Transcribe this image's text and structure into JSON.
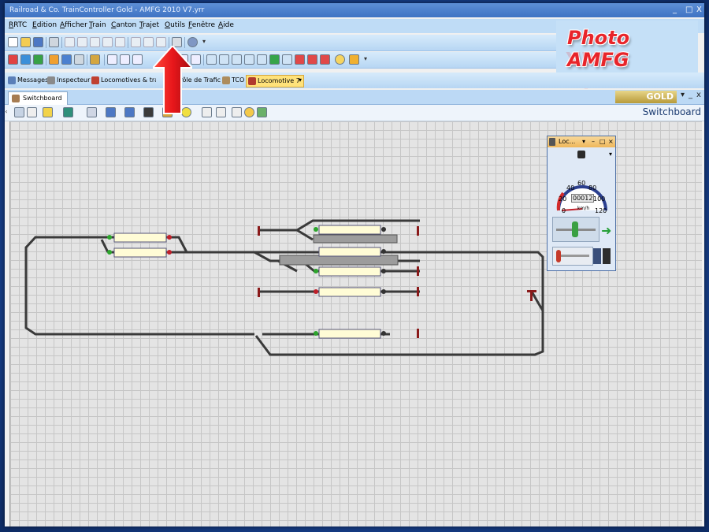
{
  "window": {
    "title": "Railroad & Co. TrainController Gold - AMFG 2010 V7.yrr",
    "controls": [
      "_",
      "□",
      "X"
    ]
  },
  "menu": [
    "RRTC",
    "Edition",
    "Afficher",
    "Train",
    "Canton",
    "Trajet",
    "Outils",
    "Fenêtre",
    "Aide"
  ],
  "brand": {
    "logo_text": "Photo AMFG"
  },
  "tabs": [
    {
      "label": "Messages",
      "icon": "messages-icon"
    },
    {
      "label": "Inspecteur",
      "icon": "inspector-icon"
    },
    {
      "label": "Locomotives & trains",
      "icon": "locomotive-icon"
    },
    {
      "label": "Contrôle de Trafic",
      "icon": "traffic-control-icon"
    },
    {
      "label": "TCO",
      "icon": "tco-icon"
    },
    {
      "label": "Locomotive 7",
      "icon": "locomotive-icon"
    }
  ],
  "document": {
    "tab_label": "Switchboard",
    "title": "Switchboard",
    "edition_badge": "GOLD",
    "controls": [
      "▾",
      "_",
      "x"
    ]
  },
  "loco_panel": {
    "title": "Loc...",
    "speed_display": "00012",
    "unit": "km/h",
    "scale": [
      "20",
      "40",
      "60",
      "80",
      "100",
      "120"
    ],
    "zero": "0"
  },
  "colors": {
    "accent": "#3f73c3",
    "menubar": "#bfdcf6",
    "highlight_arrow": "#e8171b",
    "block_fill": "#fffcd6",
    "track": "#3a3a3a",
    "signal_red": "#c0202a",
    "signal_green": "#2ca52c"
  }
}
